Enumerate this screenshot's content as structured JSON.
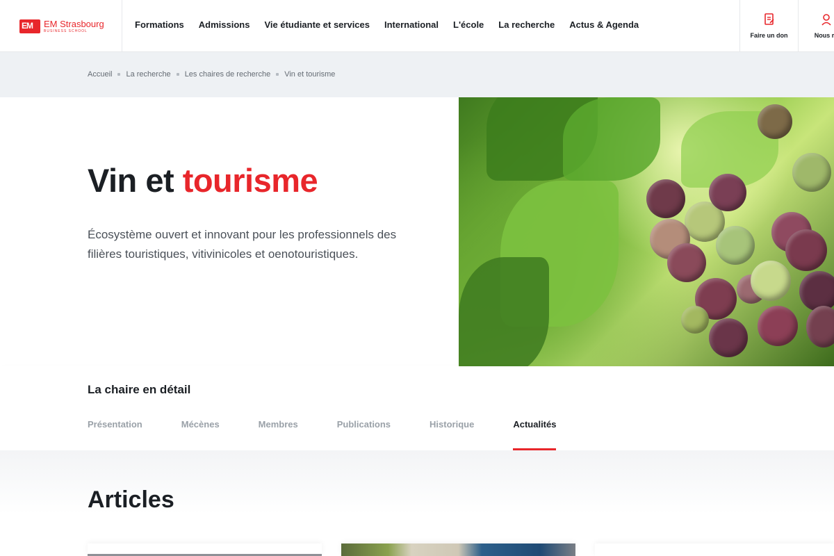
{
  "header": {
    "logo_name": "EM Strasbourg",
    "logo_sub": "BUSINESS SCHOOL",
    "nav": [
      "Formations",
      "Admissions",
      "Vie étudiante et services",
      "International",
      "L'école",
      "La recherche",
      "Actus & Agenda"
    ],
    "donate_label": "Faire un don",
    "contact_label": "Nous re",
    "accent_color": "#e8262b"
  },
  "breadcrumb": [
    "Accueil",
    "La recherche",
    "Les chaires de recherche",
    "Vin et tourisme"
  ],
  "hero": {
    "title_plain": "Vin et",
    "title_accent": "tourisme",
    "description": "Écosystème ouvert et innovant pour les professionnels des filières touristiques, vitivinicoles et oenotouristiques."
  },
  "detail": {
    "heading": "La chaire en détail",
    "tabs": [
      "Présentation",
      "Mécènes",
      "Membres",
      "Publications",
      "Historique",
      "Actualités"
    ],
    "active_tab": "Actualités"
  },
  "articles": {
    "title": "Articles"
  }
}
